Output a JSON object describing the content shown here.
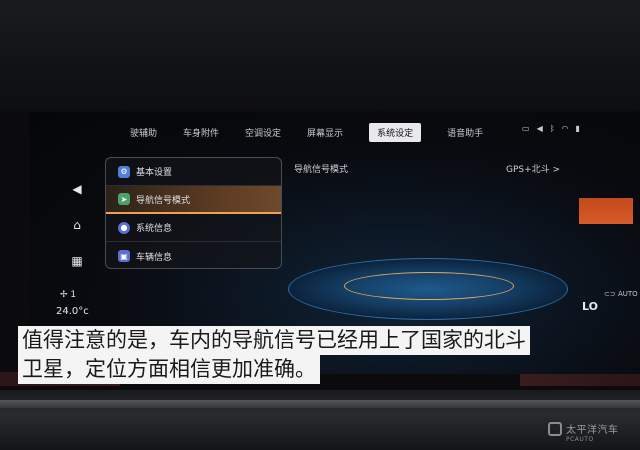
{
  "tabs": [
    {
      "label": "驾驶辅助"
    },
    {
      "label": "车身附件"
    },
    {
      "label": "空调设定"
    },
    {
      "label": "屏幕显示"
    },
    {
      "label": "系统设定"
    },
    {
      "label": "语音助手"
    }
  ],
  "tab_visible_labels": [
    "驶辅助",
    "车身附件",
    "空调设定",
    "屏幕显示",
    "系统设定",
    "语音助手"
  ],
  "active_tab": "系统设定",
  "status_icons": [
    "phone-icon",
    "volume-icon",
    "bluetooth-icon",
    "wifi-icon",
    "signal-icon"
  ],
  "menu": {
    "items": [
      {
        "label": "基本设置",
        "icon": "gear-icon",
        "icon_color": "#4f7fd6"
      },
      {
        "label": "导航信号模式",
        "icon": "navigation-icon",
        "icon_color": "#4aa26a"
      },
      {
        "label": "系统信息",
        "icon": "info-icon",
        "icon_color": "#5a6fd0"
      },
      {
        "label": "车辆信息",
        "icon": "car-info-icon",
        "icon_color": "#5a6fd0"
      }
    ],
    "active_index": 1
  },
  "content": {
    "title": "导航信号模式",
    "value": "GPS+北斗 >"
  },
  "climate": {
    "fan_level": "1",
    "left_temp": "24.0°c",
    "mode": "AUTO",
    "right_temp": "LO"
  },
  "caption": {
    "line1": "值得注意的是，车内的导航信号已经用上了国家的北斗",
    "line2": "卫星，定位方面相信更加准确。"
  },
  "watermark": {
    "brand": "太平洋汽车",
    "sub": "PCAUTO"
  },
  "colors": {
    "accent_orange": "#f0a050",
    "active_tab_bg": "#e9e9ec"
  }
}
